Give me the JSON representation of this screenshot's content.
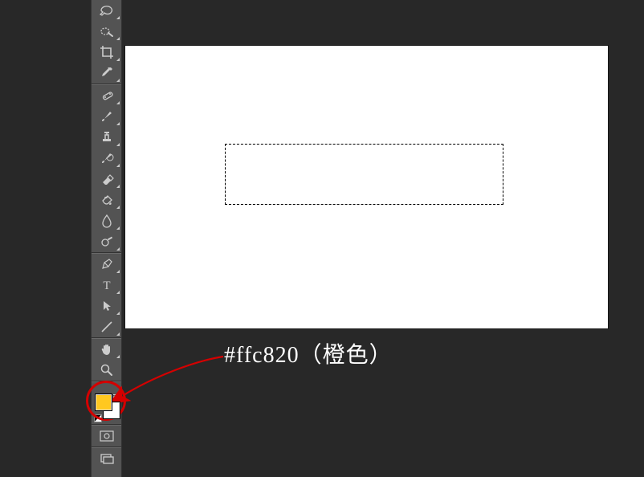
{
  "annotation": {
    "text": "#ffc820（橙色）",
    "highlight_color": "#d40000",
    "arrow_color": "#d40000"
  },
  "colors": {
    "foreground": "#ffc820",
    "background": "#ffffff",
    "canvas_bg": "#ffffff",
    "workspace_bg": "#282828",
    "toolbar_bg": "#535353"
  },
  "tools": [
    {
      "name": "lasso-tool",
      "icon": "lasso"
    },
    {
      "name": "quick-selection-tool",
      "icon": "wand-area"
    },
    {
      "name": "crop-tool",
      "icon": "crop"
    },
    {
      "name": "eyedropper-tool",
      "icon": "eyedropper"
    },
    {
      "name": "healing-brush-tool",
      "icon": "bandage"
    },
    {
      "name": "brush-tool",
      "icon": "brush"
    },
    {
      "name": "clone-stamp-tool",
      "icon": "stamp"
    },
    {
      "name": "history-brush-tool",
      "icon": "history-brush"
    },
    {
      "name": "eraser-tool",
      "icon": "eraser"
    },
    {
      "name": "gradient-tool",
      "icon": "bucket"
    },
    {
      "name": "blur-tool",
      "icon": "drop"
    },
    {
      "name": "dodge-tool",
      "icon": "dodge"
    },
    {
      "name": "pen-tool",
      "icon": "pen"
    },
    {
      "name": "text-tool",
      "icon": "T"
    },
    {
      "name": "path-selection-tool",
      "icon": "arrow"
    },
    {
      "name": "line-tool",
      "icon": "line"
    },
    {
      "name": "hand-tool",
      "icon": "hand"
    },
    {
      "name": "zoom-tool",
      "icon": "zoom"
    }
  ],
  "canvas": {
    "selection_visible": true
  },
  "bottom_tools": [
    {
      "name": "quick-mask-toggle",
      "icon": "quickmask"
    },
    {
      "name": "screen-mode-toggle",
      "icon": "screenmode"
    }
  ]
}
